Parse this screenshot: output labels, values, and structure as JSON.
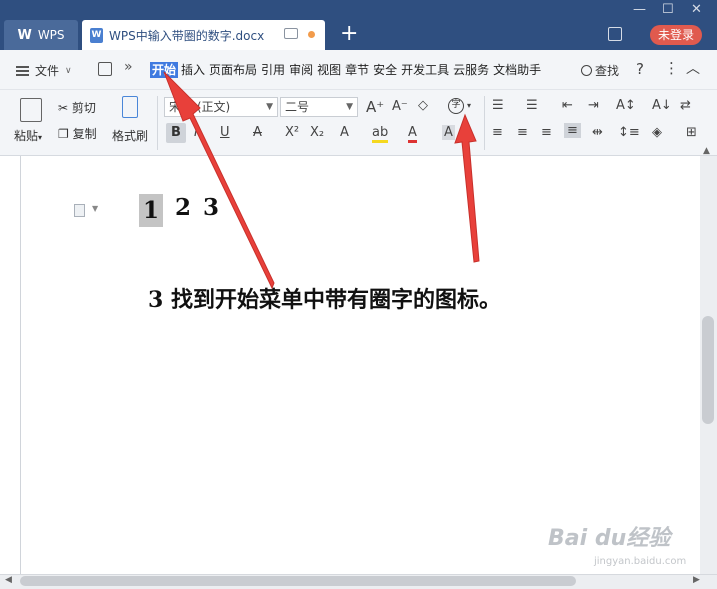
{
  "titlebar": {
    "app_tab": "WPS",
    "doc_tab": "WPS中输入带圈的数字.docx",
    "login": "未登录"
  },
  "menubar": {
    "file": "文件",
    "items": [
      "开始",
      "插入",
      "页面布局",
      "引用",
      "审阅",
      "视图",
      "章节",
      "安全",
      "开发工具",
      "云服务",
      "文档助手"
    ],
    "active": "开始",
    "find": "查找",
    "help": "?"
  },
  "ribbon": {
    "paste": "粘贴",
    "cut": "剪切",
    "copy": "复制",
    "format_painter": "格式刷",
    "font_name": "宋体 (正文)",
    "font_size": "二号",
    "bold": "B",
    "circle_char": "字"
  },
  "document": {
    "numbers": [
      "1",
      "2",
      "3"
    ],
    "instruction": "3 找到开始菜单中带有圈字的图标。"
  },
  "colors": {
    "titlebar": "#2f4f80",
    "active_menu": "#3f7ae0",
    "login_button": "#e05a4e",
    "arrow": "#e8403a"
  },
  "icons": [
    "wps-logo",
    "doc-icon",
    "monitor-icon",
    "unsaved-dot",
    "add-tab-icon",
    "hamburger-icon",
    "save-icon",
    "more-icon",
    "search-icon",
    "help-icon",
    "kebab-icon",
    "collapse-icon",
    "paste-icon",
    "cut-icon",
    "copy-icon",
    "format-painter-icon",
    "circle-char-icon",
    "paragraph-icon"
  ],
  "watermark": {
    "brand": "Bai du经验",
    "url": "jingyan.baidu.com"
  }
}
